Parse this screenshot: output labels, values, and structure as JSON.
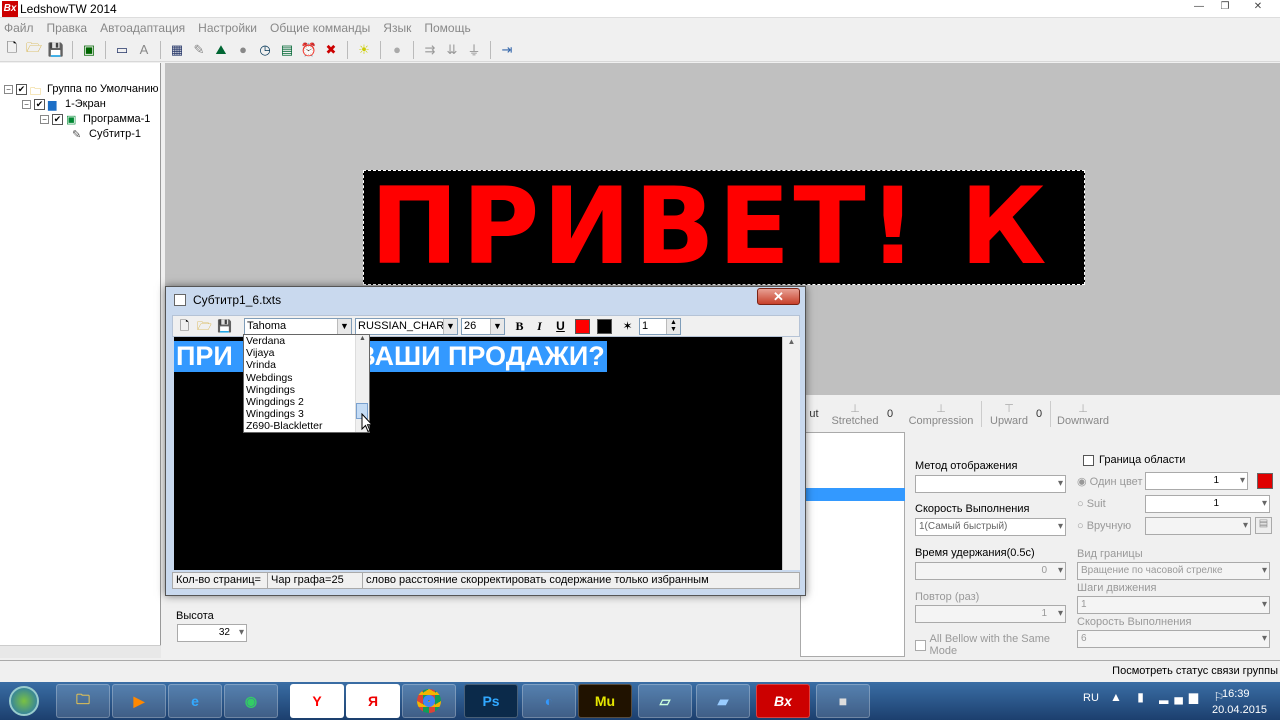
{
  "window": {
    "title": "LedshowTW 2014",
    "icon_text": "Bx"
  },
  "menu": [
    "Файл",
    "Правка",
    "Автоадаптация",
    "Настройки",
    "Общие комманды",
    "Язык",
    "Помощь"
  ],
  "toolbar_icons": [
    "new-file-icon",
    "open-folder-icon",
    "save-icon",
    "screens-icon",
    "window-icon",
    "text-icon",
    "grid-icon",
    "edit-icon",
    "image-icon",
    "video-icon",
    "clock-icon",
    "counter-icon",
    "alarm-icon",
    "delete-icon",
    "brightness-icon",
    "record-icon",
    "send-icon",
    "download-icon",
    "usb-icon",
    "exit-icon"
  ],
  "tree": {
    "group": "Группа по Умолчанию",
    "screen": "1-Экран",
    "program": "Программа-1",
    "subtitle": "Субтитр-1"
  },
  "led": {
    "text": "ПРИВЕТ! К",
    "color": "#ff0000",
    "background": "#000000"
  },
  "effects_bar": {
    "cut_label": "ut",
    "stretched": "Stretched",
    "stretched_value": "0",
    "compression": "Compression",
    "upward": "Upward",
    "upward_value": "0",
    "downward": "Downward"
  },
  "props": {
    "display_method_label": "Метод отображения",
    "display_method_value": "",
    "speed_label": "Скорость Выполнения",
    "speed_value": "1(Самый быстрый)",
    "hold_label": "Время удержания(0.5с)",
    "hold_value": "0",
    "repeat_label": "Повтор (раз)",
    "repeat_value": "1",
    "all_below_label": "All Bellow with the Same Mode"
  },
  "border": {
    "title": "Граница области",
    "one_color": "Один цвет",
    "one_color_value": "1",
    "suit": "Suit",
    "suit_value": "1",
    "manual": "Вручную",
    "type_label": "Вид границы",
    "type_value": "Вращение по часовой стрелке",
    "steps_label": "Шаги движения",
    "steps_value": "1",
    "speed_label": "Скорость Выполнения",
    "speed_value": "6",
    "accent_color": "#e00000"
  },
  "left_fields": {
    "height_label": "Высота",
    "height_value": "32"
  },
  "statusbar": {
    "text": "Посмотреть статус связи группы"
  },
  "dialog": {
    "title": "Субтитр1_6.txts",
    "font": "Tahoma",
    "charset": "RUSSIAN_CHARSE",
    "size": "26",
    "bold": "B",
    "italic": "I",
    "underline": "U",
    "fore_color": "#ff0000",
    "back_color": "#000000",
    "spacing": "1",
    "editor_text_left": "ПРИ",
    "editor_text_right": "АК ВАШИ ПРОДАЖИ?",
    "status_pages": "Кол-во страниц=",
    "status_chars": "Чар графа=25",
    "status_msg": "слово расстояние скорректировать содержание только избранным",
    "font_list": [
      "Verdana",
      "Vijaya",
      "Vrinda",
      "Webdings",
      "Wingdings",
      "Wingdings 2",
      "Wingdings 3",
      "Z690-Blackletter"
    ]
  },
  "taskbar": {
    "lang": "RU",
    "time": "16:39",
    "date": "20.04.2015",
    "apps": [
      "file-explorer",
      "media-player",
      "internet-explorer",
      "app-green",
      "yandex",
      "yandex-browser",
      "chrome",
      "photoshop",
      "app-c",
      "muse",
      "notepad",
      "paint",
      "ledshow",
      "camera"
    ],
    "app_labels": {
      "ps": "Ps",
      "mu": "Mu",
      "ya": "Я",
      "bx": "Bx"
    }
  }
}
